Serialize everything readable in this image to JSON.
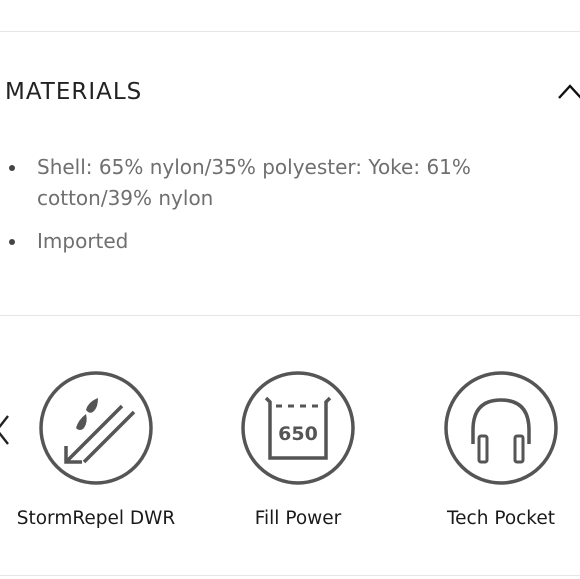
{
  "materials": {
    "title": "MATERIALS",
    "expanded": true,
    "items": [
      "Shell: 65% nylon/35% polyester: Yoke: 61% cotton/39% nylon",
      "Imported"
    ]
  },
  "features": {
    "items": [
      {
        "label": "StormRepel DWR",
        "icon": "rain-repel-icon"
      },
      {
        "label": "Fill Power",
        "icon": "fill-power-650-icon",
        "icon_text": "650"
      },
      {
        "label": "Tech Pocket",
        "icon": "headphones-icon"
      }
    ]
  },
  "colors": {
    "icon_stroke": "#555555",
    "text": "#1a1a1a",
    "muted_text": "#6f6f6f",
    "divider": "#e6e6e6"
  }
}
